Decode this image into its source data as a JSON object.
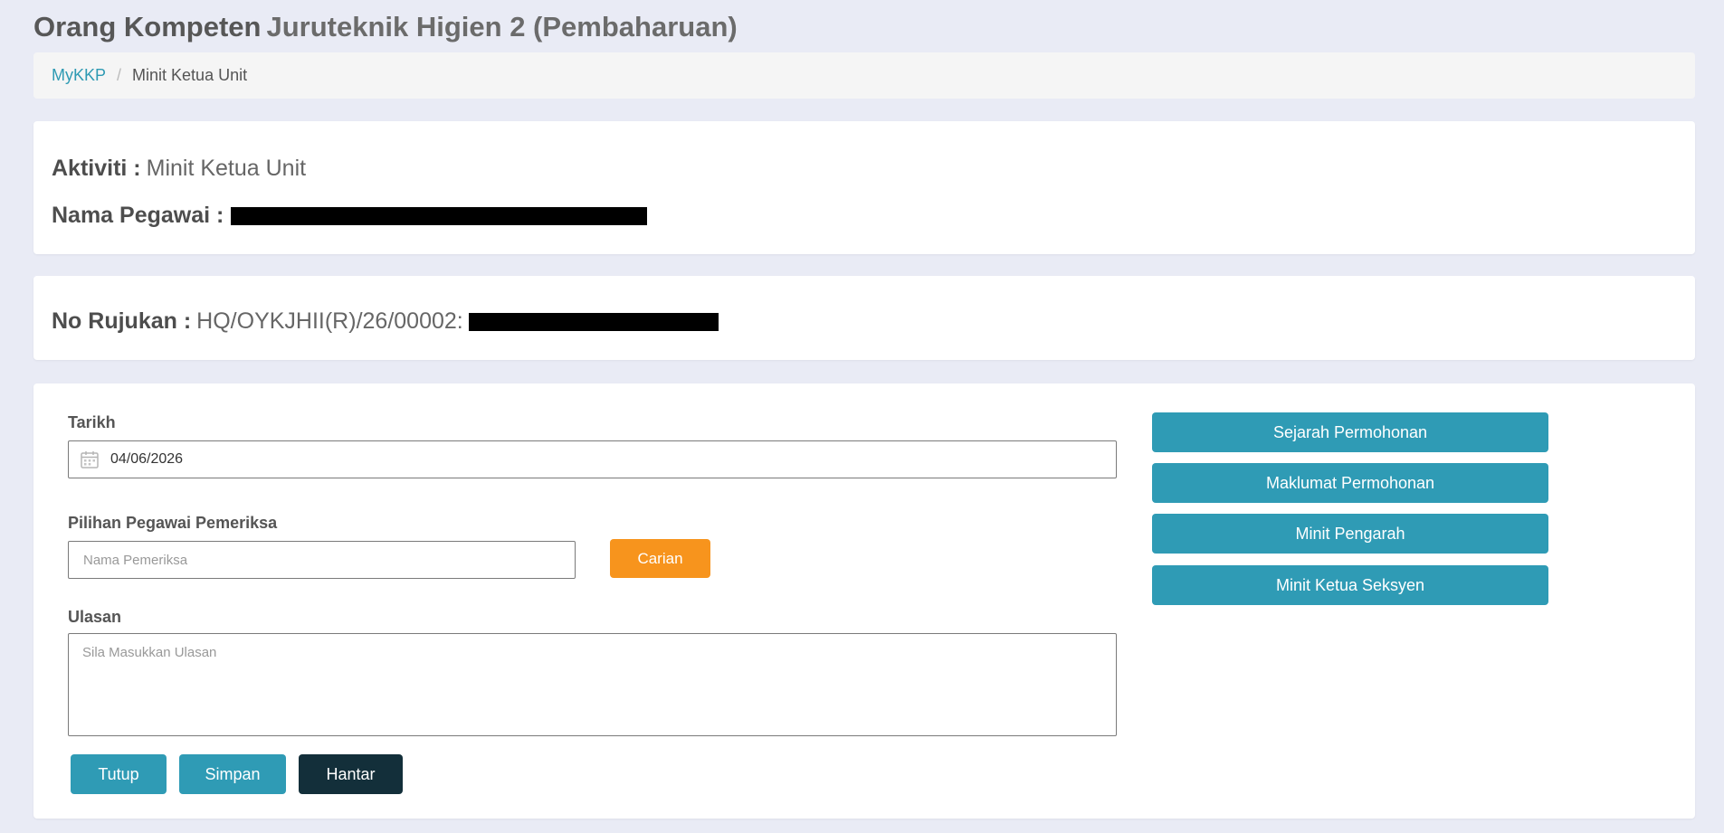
{
  "header": {
    "title_strong": "Orang Kompeten",
    "title_light": "Juruteknik Higien 2 (Pembaharuan)"
  },
  "breadcrumb": {
    "home": "MyKKP",
    "separator": "/",
    "current": "Minit Ketua Unit"
  },
  "info": {
    "aktiviti_label": "Aktiviti :",
    "aktiviti_value": "Minit Ketua Unit",
    "nama_label": "Nama Pegawai :",
    "rujukan_label": "No Rujukan :",
    "rujukan_value": "HQ/OYKJHII(R)/26/00002:"
  },
  "form": {
    "tarikh_label": "Tarikh",
    "tarikh_value": "04/06/2026",
    "pemeriksa_label": "Pilihan Pegawai Pemeriksa",
    "pemeriksa_placeholder": "Nama Pemeriksa",
    "carian_button": "Carian",
    "ulasan_label": "Ulasan",
    "ulasan_placeholder": "Sila Masukkan Ulasan"
  },
  "side_buttons": [
    "Sejarah Permohonan",
    "Maklumat Permohonan",
    "Minit Pengarah",
    "Minit Ketua Seksyen"
  ],
  "footer_buttons": {
    "tutup": "Tutup",
    "simpan": "Simpan",
    "hantar": "Hantar"
  },
  "colors": {
    "accent_teal": "#2f9bb5",
    "search_orange": "#f7941d",
    "submit_dark": "#132f3a",
    "page_background": "#e9ebf5"
  },
  "icons": {
    "date": "calendar-icon"
  }
}
